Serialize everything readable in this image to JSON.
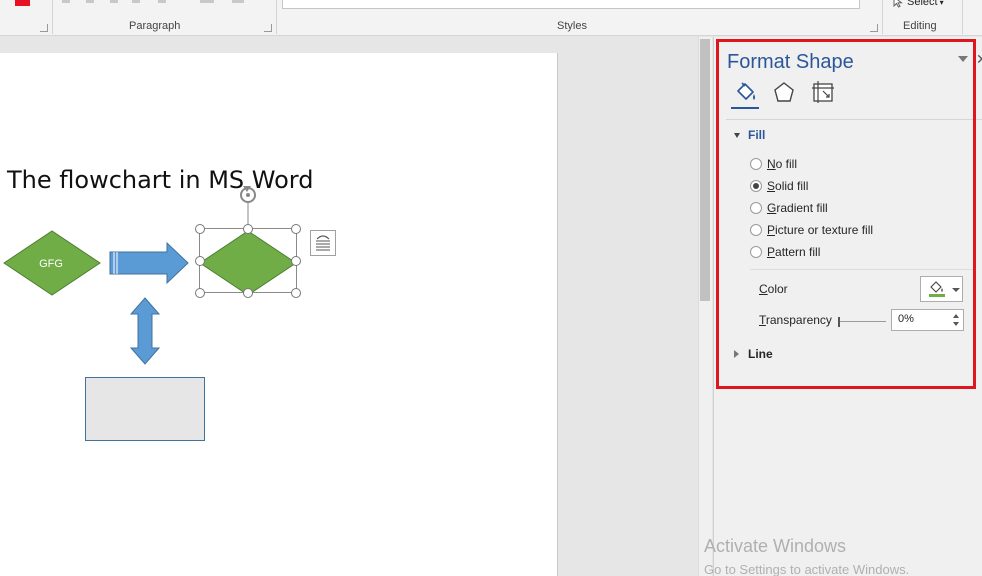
{
  "ribbon": {
    "groups": [
      {
        "label": "Paragraph"
      },
      {
        "label": "Styles"
      },
      {
        "label": "Editing"
      }
    ],
    "select_label": "Select"
  },
  "document": {
    "heading": "The flowchart in MS Word",
    "decision_label": "GFG"
  },
  "colors": {
    "diamond_fill": "#70ad47",
    "arrow_fill": "#5b9bd5",
    "box_fill": "#e7e6e6",
    "accent": "#2b579a",
    "highlight": "#e0161e"
  },
  "pane": {
    "title": "Format Shape",
    "tabs": [
      {
        "icon": "paint-bucket-icon",
        "active": true
      },
      {
        "icon": "pentagon-icon",
        "active": false
      },
      {
        "icon": "size-properties-icon",
        "active": false
      }
    ],
    "fill": {
      "label": "Fill",
      "expanded": true,
      "options": [
        {
          "label": "No fill",
          "checked": false
        },
        {
          "label": "Solid fill",
          "checked": true
        },
        {
          "label": "Gradient fill",
          "checked": false
        },
        {
          "label": "Picture or texture fill",
          "checked": false
        },
        {
          "label": "Pattern fill",
          "checked": false
        }
      ],
      "color_label": "Color",
      "transparency_label": "Transparency",
      "transparency_value": "0%",
      "transparency_level": 0
    },
    "line": {
      "label": "Line",
      "expanded": false
    }
  },
  "watermark": {
    "title": "Activate Windows",
    "subtitle": "Go to Settings to activate Windows."
  }
}
